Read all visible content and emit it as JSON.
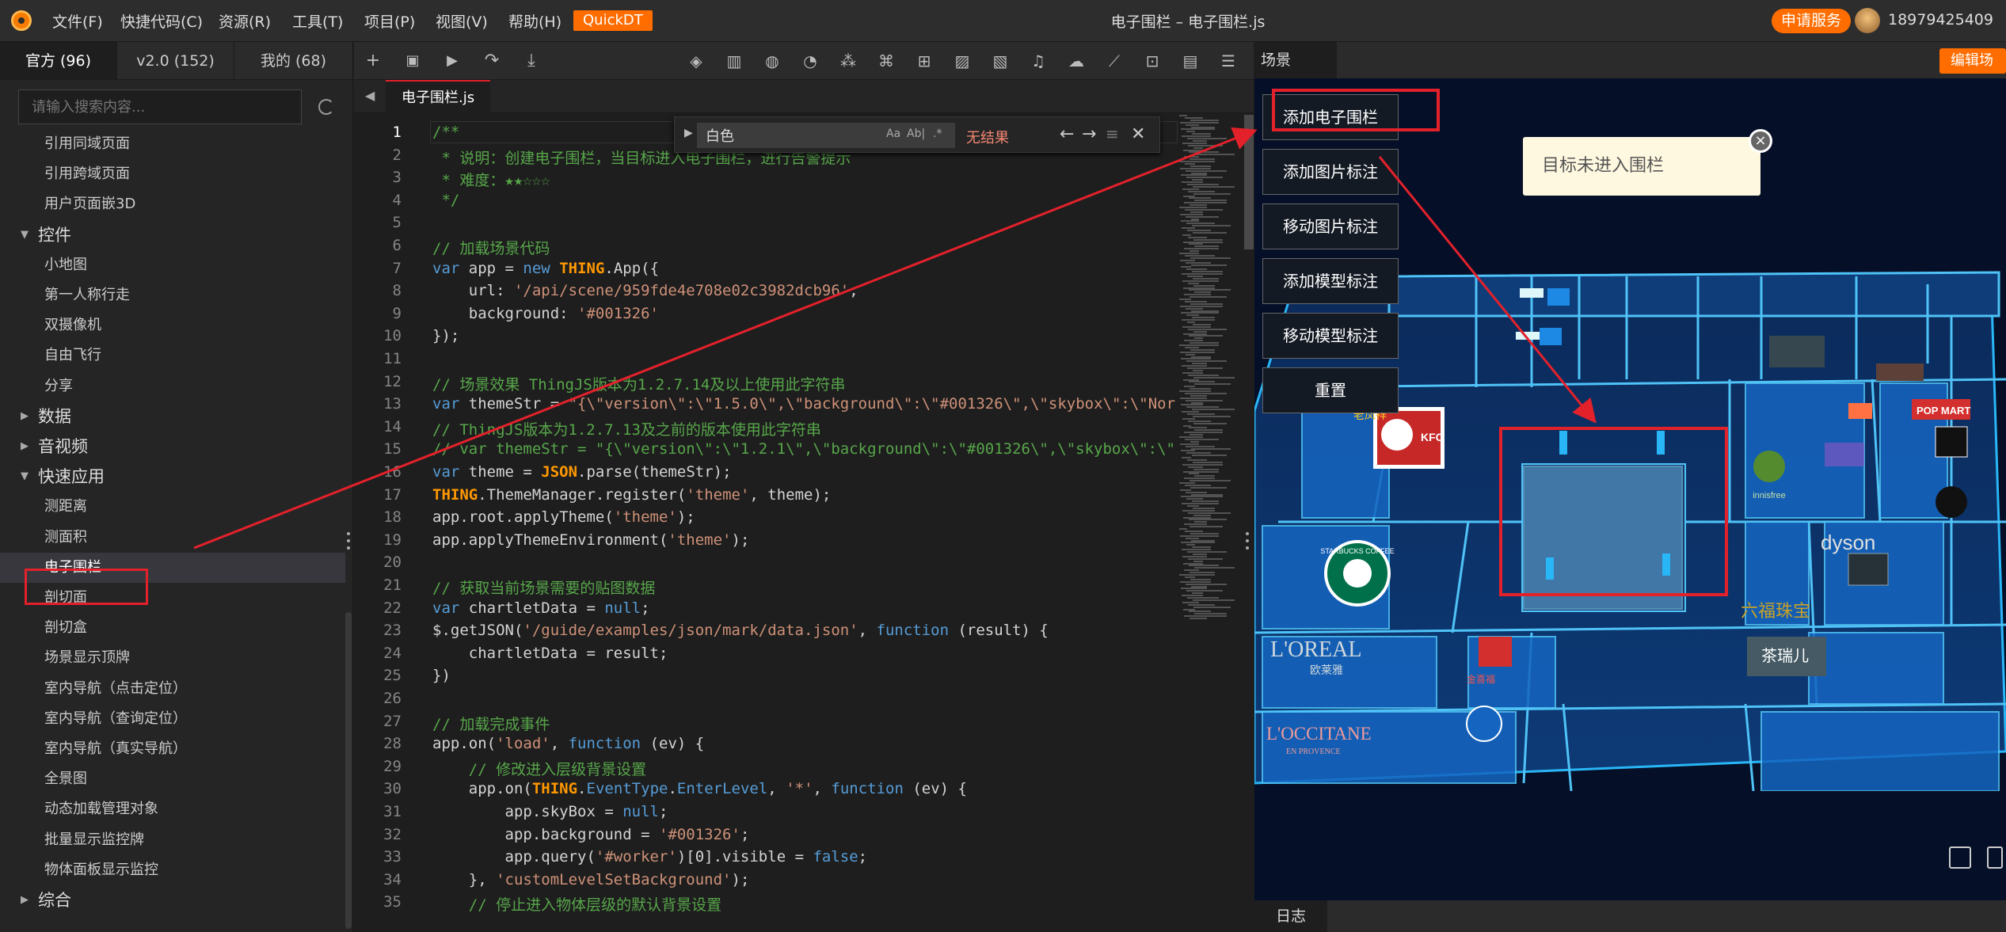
{
  "menubar": {
    "items": [
      "文件(F)",
      "快捷代码(C)",
      "资源(R)",
      "工具(T)",
      "项目(P)",
      "视图(V)",
      "帮助(H)"
    ],
    "quickdt": "QuickDT",
    "window_title": "电子围栏 – 电子围栏.js",
    "apply_service": "申请服务",
    "phone": "18979425409"
  },
  "sidebar": {
    "tabs": [
      "官方 (96)",
      "v2.0 (152)",
      "我的 (68)"
    ],
    "search_placeholder": "请输入搜索内容...",
    "tree": [
      {
        "label": "引用同域页面",
        "type": "child"
      },
      {
        "label": "引用跨域页面",
        "type": "child"
      },
      {
        "label": "用户页面嵌3D",
        "type": "child"
      },
      {
        "label": "控件",
        "type": "cat",
        "open": true
      },
      {
        "label": "小地图",
        "type": "child"
      },
      {
        "label": "第一人称行走",
        "type": "child"
      },
      {
        "label": "双摄像机",
        "type": "child"
      },
      {
        "label": "自由飞行",
        "type": "child"
      },
      {
        "label": "分享",
        "type": "child"
      },
      {
        "label": "数据",
        "type": "cat",
        "open": false
      },
      {
        "label": "音视频",
        "type": "cat",
        "open": false
      },
      {
        "label": "快速应用",
        "type": "cat",
        "open": true
      },
      {
        "label": "测距离",
        "type": "child"
      },
      {
        "label": "测面积",
        "type": "child"
      },
      {
        "label": "电子围栏",
        "type": "child",
        "selected": true
      },
      {
        "label": "剖切面",
        "type": "child"
      },
      {
        "label": "剖切盒",
        "type": "child"
      },
      {
        "label": "场景显示顶牌",
        "type": "child"
      },
      {
        "label": "室内导航（点击定位）",
        "type": "child"
      },
      {
        "label": "室内导航（查询定位）",
        "type": "child"
      },
      {
        "label": "室内导航（真实导航）",
        "type": "child"
      },
      {
        "label": "全景图",
        "type": "child"
      },
      {
        "label": "动态加载管理对象",
        "type": "child"
      },
      {
        "label": "批量显示监控牌",
        "type": "child"
      },
      {
        "label": "物体面板显示监控",
        "type": "child"
      },
      {
        "label": "综合",
        "type": "cat",
        "open": false
      }
    ]
  },
  "editor": {
    "file_tab": "电子围栏.js",
    "find": {
      "value": "白色",
      "match_case": "Aa",
      "whole_word": "Ab|",
      "regex": ".*",
      "result": "无结果"
    },
    "lines": [
      "/**",
      " * 说明：创建电子围栏，当目标进入电子围栏，进行告警提示",
      " * 难度：★★☆☆☆",
      " */",
      "",
      "// 加载场景代码",
      "var app = new THING.App({",
      "    url: '/api/scene/959fde4e708e02c3982dcb96',",
      "    background: '#001326'",
      "});",
      "",
      "// 场景效果 ThingJS版本为1.2.7.14及以上使用此字符串",
      "var themeStr = \"{\\\"version\\\":\\\"1.5.0\\\",\\\"background\\\":\\\"#001326\\\",\\\"skybox\\\":\\\"Nor",
      "// ThingJS版本为1.2.7.13及之前的版本使用此字符串",
      "// var themeStr = \"{\\\"version\\\":\\\"1.2.1\\\",\\\"background\\\":\\\"#001326\\\",\\\"skybox\\\":\\\"",
      "var theme = JSON.parse(themeStr);",
      "THING.ThemeManager.register('theme', theme);",
      "app.root.applyTheme('theme');",
      "app.applyThemeEnvironment('theme');",
      "",
      "// 获取当前场景需要的贴图数据",
      "var chartletData = null;",
      "$.getJSON('/guide/examples/json/mark/data.json', function (result) {",
      "    chartletData = result;",
      "})",
      "",
      "// 加载完成事件",
      "app.on('load', function (ev) {",
      "    // 修改进入层级背景设置",
      "    app.on(THING.EventType.EnterLevel, '*', function (ev) {",
      "        app.skyBox = null;",
      "        app.background = '#001326';",
      "        app.query('#worker')[0].visible = false;",
      "    }, 'customLevelSetBackground');",
      "    // 停止进入物体层级的默认背景设置"
    ]
  },
  "scene": {
    "tab": "场景",
    "edit_button": "编辑场景",
    "buttons": [
      "添加电子围栏",
      "添加图片标注",
      "移动图片标注",
      "添加模型标注",
      "移动模型标注",
      "重置"
    ],
    "tip": "目标未进入围栏",
    "log_tab": "日志",
    "stores": [
      "KFC",
      "STARBUCKS COFFEE",
      "L'OREAL",
      "欧莱雅",
      "L'OCCITANE",
      "EN PROVENCE",
      "dyson",
      "POP MART",
      "innisfree",
      "六福珠宝",
      "茶瑞儿",
      "金喜福",
      "老凤祥"
    ]
  },
  "colors": {
    "accent": "#ff6d00",
    "annotation": "#e3212b",
    "scene_bg": "#050f28",
    "wall": "#29b6f6"
  }
}
